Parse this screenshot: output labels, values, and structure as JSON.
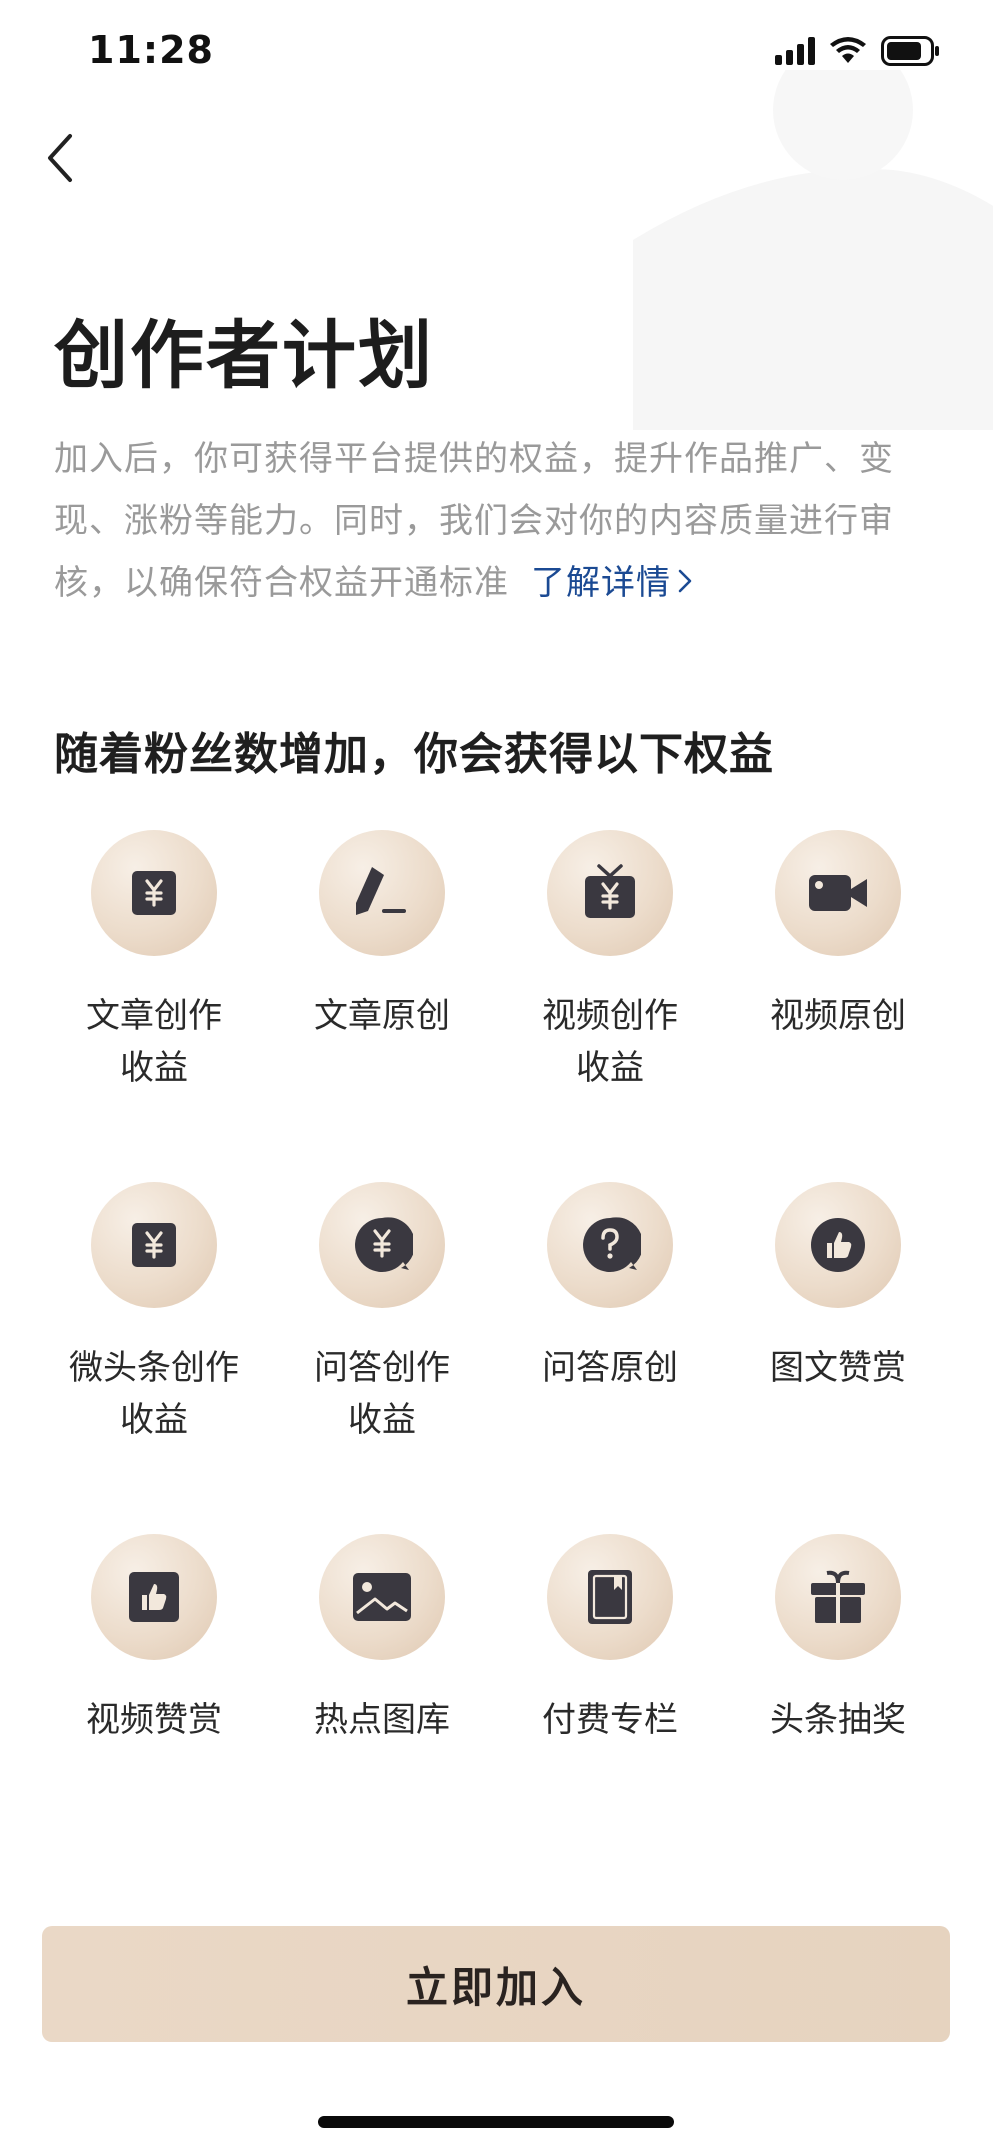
{
  "status_bar": {
    "time": "11:28"
  },
  "header": {
    "title": "创作者计划"
  },
  "intro": {
    "text": "加入后，你可获得平台提供的权益，提升作品推广、变现、涨粉等能力。同时，我们会对你的内容质量进行审核，以确保符合权益开通标准",
    "link_label": "了解详情"
  },
  "section": {
    "title": "随着粉丝数增加，你会获得以下权益"
  },
  "benefits": [
    {
      "label": "文章创作\n收益",
      "icon": "yuan-document-icon"
    },
    {
      "label": "文章原创",
      "icon": "pen-icon"
    },
    {
      "label": "视频创作\n收益",
      "icon": "tv-yuan-icon"
    },
    {
      "label": "视频原创",
      "icon": "video-camera-icon"
    },
    {
      "label": "微头条创作\n收益",
      "icon": "yuan-document-icon"
    },
    {
      "label": "问答创作\n收益",
      "icon": "yuan-bubble-icon"
    },
    {
      "label": "问答原创",
      "icon": "question-bubble-icon"
    },
    {
      "label": "图文赞赏",
      "icon": "thumbs-up-circle-icon"
    },
    {
      "label": "视频赞赏",
      "icon": "thumbs-up-square-icon"
    },
    {
      "label": "热点图库",
      "icon": "image-icon"
    },
    {
      "label": "付费专栏",
      "icon": "book-icon"
    },
    {
      "label": "头条抽奖",
      "icon": "gift-icon"
    },
    {
      "label": "",
      "icon": "partial-icon"
    },
    {
      "label": "",
      "icon": "partial-icon"
    },
    {
      "label": "",
      "icon": "partial-icon"
    },
    {
      "label": "",
      "icon": "partial-icon"
    }
  ],
  "cta": {
    "join_label": "立即加入"
  },
  "colors": {
    "accent_link": "#1b4a93",
    "button_bg": "#e8d6c3",
    "icon_dark": "#3a3840"
  }
}
